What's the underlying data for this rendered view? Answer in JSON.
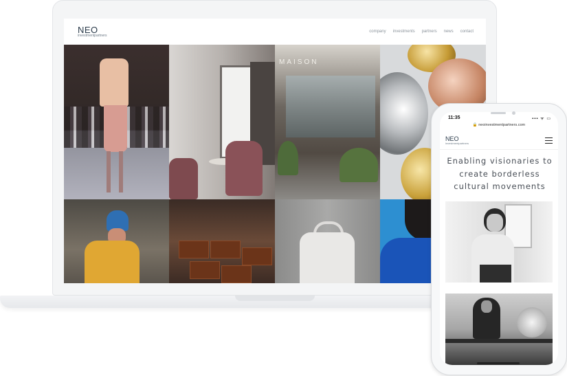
{
  "laptop_site": {
    "logo": "NEO",
    "logo_sub": "investmentpartners",
    "nav": [
      "company",
      "investments",
      "partners",
      "news",
      "contact"
    ]
  },
  "maison_sign": "MAISON",
  "mobile_site": {
    "status_time": "11:35",
    "status_icons": "▪▪▪ ᯤ ▭",
    "url": "🔒 neoinvestmentpartners.com",
    "logo": "NEO",
    "logo_sub": "investmentpartners",
    "headline_lines": [
      "Enabling visionaries to",
      "create borderless",
      "cultural movements"
    ]
  },
  "colors": {
    "logo_text": "#2a3a4a",
    "nav_text": "#8b939b",
    "headline_text": "#474d55"
  },
  "icons": [
    "hamburger-menu-icon",
    "lock-icon"
  ]
}
